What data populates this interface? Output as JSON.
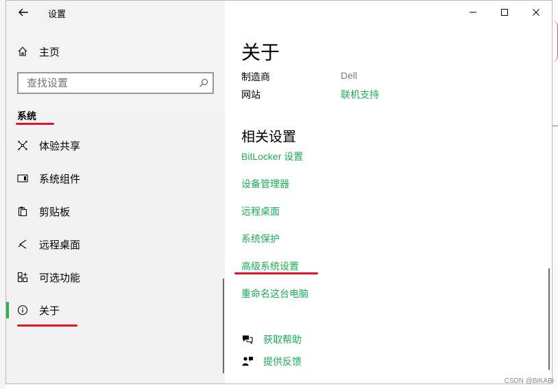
{
  "window": {
    "title": "设置"
  },
  "sidebar": {
    "home_label": "主页",
    "search_placeholder": "查找设置",
    "section_title": "系统",
    "items": [
      {
        "label": "体验共享",
        "icon": "share-experience-icon"
      },
      {
        "label": "系统组件",
        "icon": "system-components-icon"
      },
      {
        "label": "剪贴板",
        "icon": "clipboard-icon"
      },
      {
        "label": "远程桌面",
        "icon": "remote-desktop-icon"
      },
      {
        "label": "可选功能",
        "icon": "optional-features-icon"
      },
      {
        "label": "关于",
        "icon": "info-icon",
        "active": true
      }
    ]
  },
  "main": {
    "page_title": "关于",
    "info": [
      {
        "key": "制造商",
        "value": "Dell"
      },
      {
        "key": "网站",
        "value": "联机支持"
      }
    ],
    "related_title": "相关设置",
    "related_links": [
      "BitLocker 设置",
      "设备管理器",
      "远程桌面",
      "系统保护",
      "高级系统设置",
      "重命名这台电脑"
    ],
    "help": {
      "get_help": "获取帮助",
      "feedback": "提供反馈"
    }
  },
  "watermark": "CSDN @BiKABi",
  "colors": {
    "accent": "#1aae57",
    "annotation_red": "#e81123",
    "active_indicator": "#2fb14a"
  }
}
